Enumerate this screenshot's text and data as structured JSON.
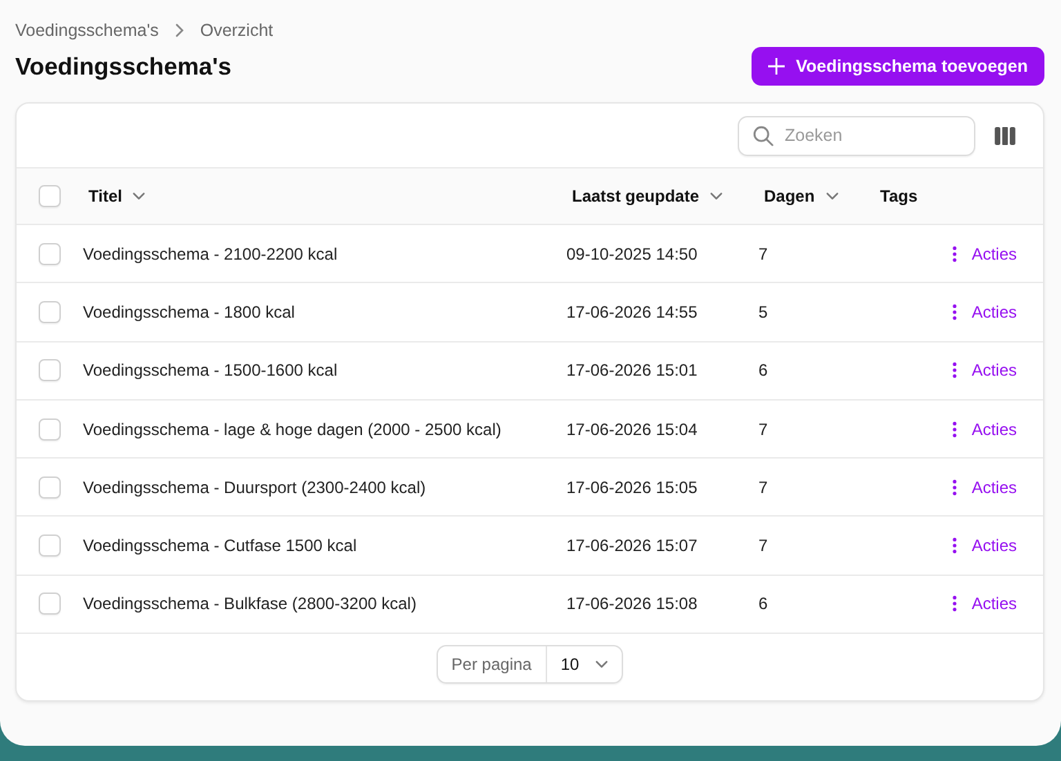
{
  "breadcrumb": [
    "Voedingsschema's",
    "Overzicht"
  ],
  "page_title": "Voedingsschema's",
  "add_button": {
    "label": "Voedingsschema toevoegen"
  },
  "search": {
    "placeholder": "Zoeken"
  },
  "table": {
    "select_all": {
      "checked": false
    },
    "columns": [
      {
        "label": "Titel",
        "sortable": true
      },
      {
        "label": "Laatst geupdate",
        "sortable": true
      },
      {
        "label": "Dagen",
        "sortable": true
      },
      {
        "label": "Tags",
        "sortable": false
      }
    ],
    "rows": [
      {
        "checked": false,
        "title": "Voedingsschema - 2100-2200 kcal",
        "updated": "09-10-2025 14:50",
        "days": "7",
        "action": "Acties"
      },
      {
        "checked": false,
        "title": "Voedingsschema - 1800 kcal",
        "updated": "17-06-2026 14:55",
        "days": "5",
        "action": "Acties"
      },
      {
        "checked": false,
        "title": "Voedingsschema - 1500-1600 kcal",
        "updated": "17-06-2026 15:01",
        "days": "6",
        "action": "Acties"
      },
      {
        "checked": false,
        "title": "Voedingsschema - lage & hoge dagen (2000 - 2500 kcal)",
        "updated": "17-06-2026 15:04",
        "days": "7",
        "action": "Acties"
      },
      {
        "checked": false,
        "title": "Voedingsschema - Duursport (2300-2400 kcal)",
        "updated": "17-06-2026 15:05",
        "days": "7",
        "action": "Acties"
      },
      {
        "checked": false,
        "title": "Voedingsschema - Cutfase 1500 kcal",
        "updated": "17-06-2026 15:07",
        "days": "7",
        "action": "Acties"
      },
      {
        "checked": false,
        "title": "Voedingsschema - Bulkfase (2800-3200 kcal)",
        "updated": "17-06-2026 15:08",
        "days": "6",
        "action": "Acties"
      }
    ]
  },
  "pagination": {
    "label": "Per pagina",
    "value": "10"
  }
}
